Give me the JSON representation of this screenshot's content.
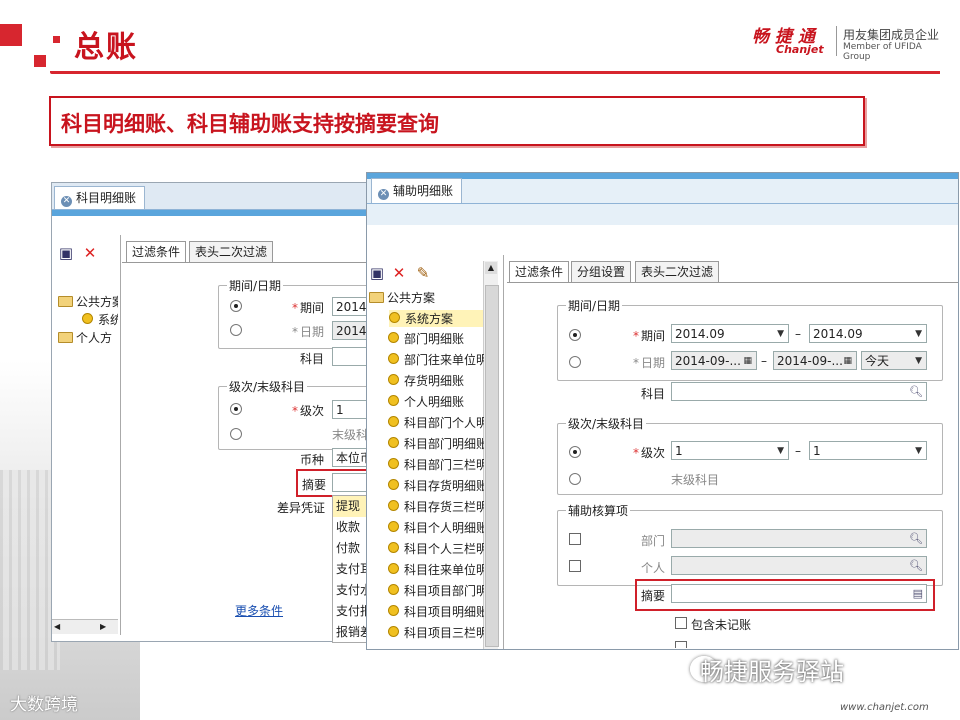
{
  "slide": {
    "title": "总账",
    "subtitle": "科目明细账、科目辅助账支持按摘要查询",
    "logo_cn": "畅 捷 通",
    "logo_en": "Chanjet",
    "logo_group": "用友集团成员企业",
    "logo_member": "Member of UFIDA Group",
    "watermark_left": "大数跨境",
    "watermark_right": "畅捷服务驿站",
    "url": "www.chanjet.com",
    "accent": "#c8141e"
  },
  "left_window": {
    "tab_title": "科目明细账",
    "tree": [
      "公共方案",
      "系统",
      "个人方"
    ],
    "filter_tabs": [
      "过滤条件",
      "表头二次过滤"
    ],
    "period_group": "期间/日期",
    "period_label": "期间",
    "period_value": "2014.",
    "date_label": "日期",
    "date_value": "2014-",
    "subject_label": "科目",
    "level_group": "级次/末级科目",
    "level_label": "级次",
    "level_value": "1",
    "last_level": "末级科",
    "currency_label": "币种",
    "currency_value": "本位币",
    "summary_label": "摘要",
    "diff_label": "差异凭证",
    "diff_options": [
      "提现",
      "收款",
      "付款",
      "支付耳",
      "支付水",
      "支付报",
      "报销差"
    ],
    "more_link": "更多条件"
  },
  "right_window": {
    "tab_title": "辅助明细账",
    "tree_root": "公共方案",
    "tree_items": [
      "系统方案",
      "部门明细账",
      "部门往来单位明",
      "存货明细账",
      "个人明细账",
      "科目部门个人明",
      "科目部门明细账",
      "科目部门三栏明",
      "科目存货明细账",
      "科目存货三栏明",
      "科目个人明细账",
      "科目个人三栏明",
      "科目往来单位明",
      "科目项目部门明",
      "科目项目明细账",
      "科目项目三栏明"
    ],
    "filter_tabs": [
      "过滤条件",
      "分组设置",
      "表头二次过滤"
    ],
    "period_group": "期间/日期",
    "period_label": "期间",
    "period_from": "2014.09",
    "period_to": "2014.09",
    "date_label": "日期",
    "date_from": "2014-09-...",
    "date_to": "2014-09-...",
    "date_quick": "今天",
    "subject_label": "科目",
    "level_group": "级次/末级科目",
    "level_label": "级次",
    "level_from": "1",
    "level_to": "1",
    "last_level": "末级科目",
    "aux_group": "辅助核算项",
    "dept_label": "部门",
    "person_label": "个人",
    "summary_label": "摘要",
    "include_unposted": "包含未记账",
    "dash": "–"
  }
}
